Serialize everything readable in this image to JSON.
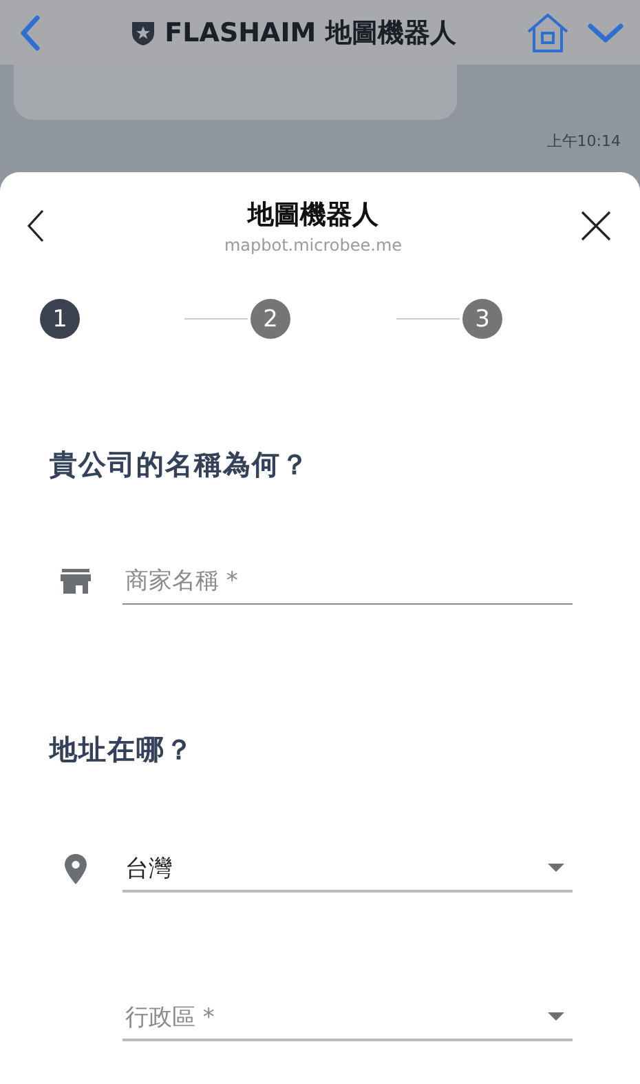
{
  "top_bar": {
    "title": "FLASHAIM 地圖機器人"
  },
  "chat": {
    "time": "上午10:14"
  },
  "sheet": {
    "title": "地圖機器人",
    "url": "mapbot.microbee.me"
  },
  "steps": [
    {
      "label": "1",
      "selected": true
    },
    {
      "label": "2",
      "selected": false
    },
    {
      "label": "3",
      "selected": false
    }
  ],
  "sections": [
    {
      "heading": "貴公司的名稱為何？",
      "fields": [
        {
          "kind": "business",
          "placeholder": "商家名稱 *"
        }
      ]
    },
    {
      "heading": "地址在哪？",
      "fields": [
        {
          "kind": "country",
          "value": "台灣"
        },
        {
          "kind": "region",
          "placeholder": "行政區 *"
        }
      ]
    }
  ]
}
